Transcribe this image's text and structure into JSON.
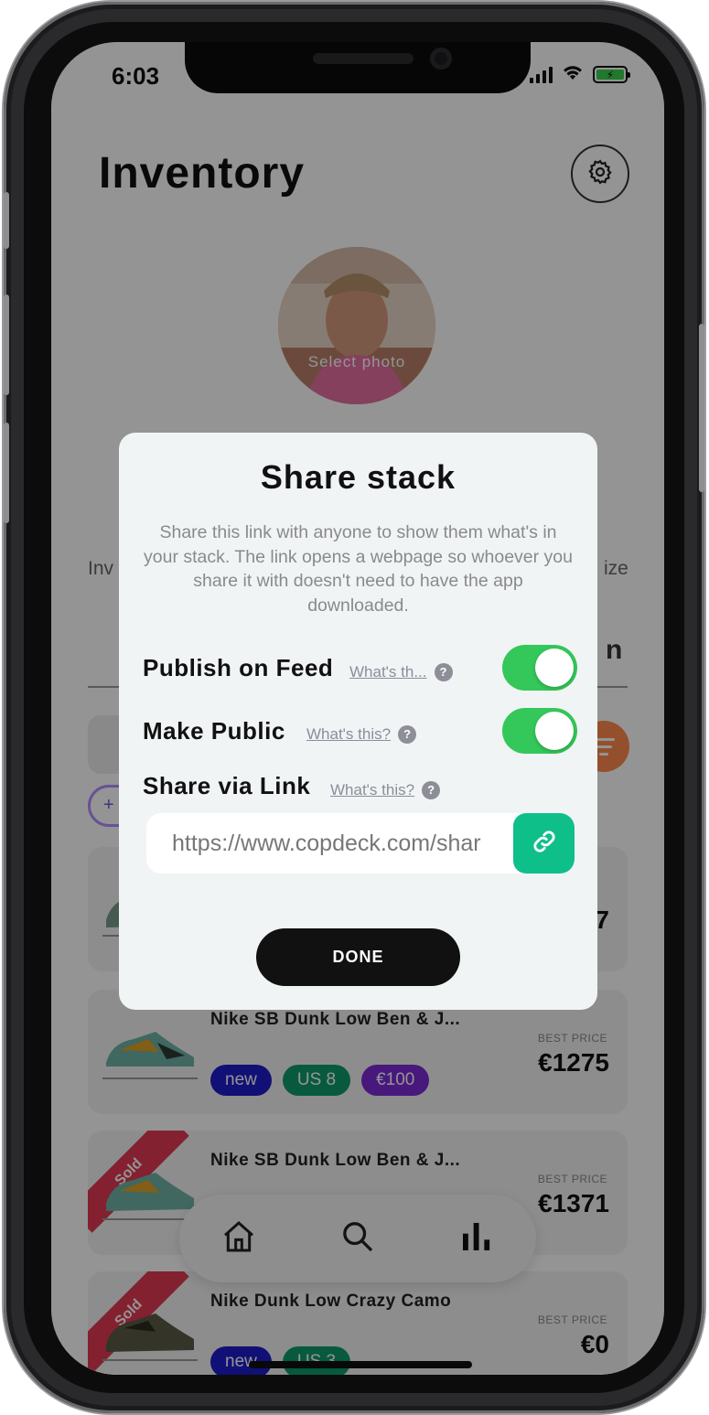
{
  "status_bar": {
    "time": "6:03",
    "battery_icon": "battery-charging-icon",
    "wifi_icon": "wifi-icon",
    "signal_icon": "signal-icon"
  },
  "page": {
    "title": "Inventory",
    "settings_icon": "gear-icon"
  },
  "profile": {
    "avatar_label": "Select photo"
  },
  "background_hints": {
    "text_left": "Inv",
    "text_right": "ize",
    "tab_fragment": "n",
    "chip_fragment": "+"
  },
  "cards": [
    {
      "title": "",
      "best_label": "",
      "best_value": "7",
      "sold": false,
      "tags": []
    },
    {
      "title": "Nike SB Dunk Low Ben & J...",
      "best_label": "BEST PRICE",
      "best_value": "€1275",
      "sold": false,
      "tags": [
        {
          "label": "new"
        },
        {
          "label": "US 8"
        },
        {
          "label": "€100"
        }
      ]
    },
    {
      "title": "Nike SB Dunk Low Ben & J...",
      "best_label": "BEST PRICE",
      "best_value": "€1371",
      "sold": true,
      "sold_label": "Sold",
      "tags": []
    },
    {
      "title": "Nike Dunk Low Crazy Camo",
      "best_label": "BEST PRICE",
      "best_value": "€0",
      "sold": true,
      "sold_label": "Sold",
      "tags": [
        {
          "label": "new"
        },
        {
          "label": "US 3"
        }
      ]
    }
  ],
  "bottom_nav": {
    "items": [
      "home-icon",
      "search-icon",
      "bar-chart-icon"
    ]
  },
  "modal": {
    "title": "Share stack",
    "description": "Share this link with anyone to show them what's in your stack. The link opens a webpage so whoever you share it with doesn't need to have the app downloaded.",
    "publish_on_feed": {
      "label": "Publish on Feed",
      "help": "What's th...",
      "enabled": true
    },
    "make_public": {
      "label": "Make Public",
      "help": "What's this?",
      "enabled": true
    },
    "share_via_link": {
      "label": "Share via Link",
      "help": "What's this?"
    },
    "link_value": "https://www.copdeck.com/shar",
    "help_glyph": "?",
    "copy_icon": "link-icon",
    "done_label": "DONE"
  },
  "colors": {
    "toggle_on": "#34c759",
    "copy_button": "#0fbf8a",
    "done_button": "#111111",
    "sold_ribbon": "#e23a54",
    "filter_button": "#ff8a4c"
  }
}
